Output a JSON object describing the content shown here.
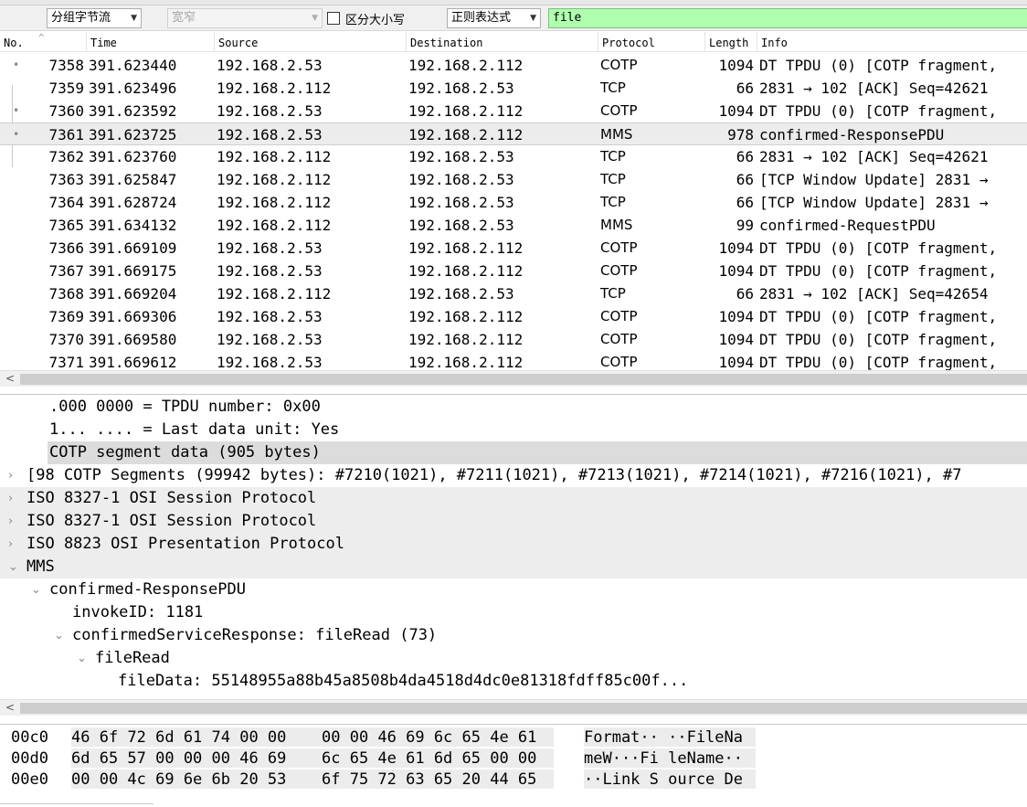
{
  "toolbar": {
    "search_in": "分组字节流",
    "char_width": "宽窄",
    "case_sensitive_label": "区分大小写",
    "search_type": "正则表达式",
    "search_value": "file"
  },
  "packet_list": {
    "columns": [
      "No.",
      "Time",
      "Source",
      "Destination",
      "Protocol",
      "Length",
      "Info"
    ],
    "selected_index": 3,
    "rows": [
      {
        "no": "7358",
        "time": "391.623440",
        "src": "192.168.2.53",
        "dst": "192.168.2.112",
        "proto": "COTP",
        "len": "1094",
        "info": "DT TPDU (0) [COTP fragment,"
      },
      {
        "no": "7359",
        "time": "391.623496",
        "src": "192.168.2.112",
        "dst": "192.168.2.53",
        "proto": "TCP",
        "len": "66",
        "info": "2831 → 102 [ACK] Seq=42621"
      },
      {
        "no": "7360",
        "time": "391.623592",
        "src": "192.168.2.53",
        "dst": "192.168.2.112",
        "proto": "COTP",
        "len": "1094",
        "info": "DT TPDU (0) [COTP fragment,"
      },
      {
        "no": "7361",
        "time": "391.623725",
        "src": "192.168.2.53",
        "dst": "192.168.2.112",
        "proto": "MMS",
        "len": "978",
        "info": "confirmed-ResponsePDU"
      },
      {
        "no": "7362",
        "time": "391.623760",
        "src": "192.168.2.112",
        "dst": "192.168.2.53",
        "proto": "TCP",
        "len": "66",
        "info": "2831 → 102 [ACK] Seq=42621"
      },
      {
        "no": "7363",
        "time": "391.625847",
        "src": "192.168.2.112",
        "dst": "192.168.2.53",
        "proto": "TCP",
        "len": "66",
        "info": "[TCP Window Update] 2831 →"
      },
      {
        "no": "7364",
        "time": "391.628724",
        "src": "192.168.2.112",
        "dst": "192.168.2.53",
        "proto": "TCP",
        "len": "66",
        "info": "[TCP Window Update] 2831 →"
      },
      {
        "no": "7365",
        "time": "391.634132",
        "src": "192.168.2.112",
        "dst": "192.168.2.53",
        "proto": "MMS",
        "len": "99",
        "info": "confirmed-RequestPDU"
      },
      {
        "no": "7366",
        "time": "391.669109",
        "src": "192.168.2.53",
        "dst": "192.168.2.112",
        "proto": "COTP",
        "len": "1094",
        "info": "DT TPDU (0) [COTP fragment,"
      },
      {
        "no": "7367",
        "time": "391.669175",
        "src": "192.168.2.53",
        "dst": "192.168.2.112",
        "proto": "COTP",
        "len": "1094",
        "info": "DT TPDU (0) [COTP fragment,"
      },
      {
        "no": "7368",
        "time": "391.669204",
        "src": "192.168.2.112",
        "dst": "192.168.2.53",
        "proto": "TCP",
        "len": "66",
        "info": "2831 → 102 [ACK] Seq=42654"
      },
      {
        "no": "7369",
        "time": "391.669306",
        "src": "192.168.2.53",
        "dst": "192.168.2.112",
        "proto": "COTP",
        "len": "1094",
        "info": "DT TPDU (0) [COTP fragment,"
      },
      {
        "no": "7370",
        "time": "391.669580",
        "src": "192.168.2.53",
        "dst": "192.168.2.112",
        "proto": "COTP",
        "len": "1094",
        "info": "DT TPDU (0) [COTP fragment,"
      },
      {
        "no": "7371",
        "time": "391.669612",
        "src": "192.168.2.53",
        "dst": "192.168.2.112",
        "proto": "COTP",
        "len": "1094",
        "info": "DT TPDU (0) [COTP fragment,"
      }
    ]
  },
  "details": {
    "rows": [
      {
        "text": ".000 0000 = TPDU number: 0x00",
        "twisty": "",
        "indent": 2,
        "gray": false
      },
      {
        "text": "1... .... = Last data unit: Yes",
        "twisty": "",
        "indent": 2,
        "gray": false
      },
      {
        "text": "COTP segment data (905 bytes)",
        "twisty": "",
        "indent": 2,
        "gray": false,
        "highlight": true
      },
      {
        "text": "[98 COTP Segments (99942 bytes): #7210(1021), #7211(1021), #7213(1021), #7214(1021), #7216(1021), #7",
        "twisty": "›",
        "indent": 1,
        "gray": false
      },
      {
        "text": "ISO 8327-1 OSI Session Protocol",
        "twisty": "›",
        "indent": 1,
        "gray": true
      },
      {
        "text": "ISO 8327-1 OSI Session Protocol",
        "twisty": "›",
        "indent": 1,
        "gray": true
      },
      {
        "text": "ISO 8823 OSI Presentation Protocol",
        "twisty": "›",
        "indent": 1,
        "gray": true
      },
      {
        "text": "MMS",
        "twisty": "⌄",
        "indent": 1,
        "gray": true
      },
      {
        "text": "confirmed-ResponsePDU",
        "twisty": "⌄",
        "indent": 2,
        "gray": false
      },
      {
        "text": "invokeID: 1181",
        "twisty": "",
        "indent": 3,
        "gray": false
      },
      {
        "text": "confirmedServiceResponse: fileRead (73)",
        "twisty": "⌄",
        "indent": 3,
        "gray": false
      },
      {
        "text": "fileRead",
        "twisty": "⌄",
        "indent": 4,
        "gray": false
      },
      {
        "text": "fileData: 55148955a88b45a8508b4da4518d4dc0e81318fdff85c00f...",
        "twisty": "",
        "indent": 5,
        "gray": false
      }
    ]
  },
  "hex": {
    "rows": [
      {
        "offset": "00c0",
        "bytes_a": "46 6f 72 6d 61 74 00 00",
        "bytes_b": "00 00 46 69 6c 65 4e 61",
        "ascii": "Format·· ··FileNa"
      },
      {
        "offset": "00d0",
        "bytes_a": "6d 65 57 00 00 00 46 69",
        "bytes_b": "6c 65 4e 61 6d 65 00 00",
        "ascii": "meW···Fi leName··"
      },
      {
        "offset": "00e0",
        "bytes_a": "00 00 4c 69 6e 6b 20 53",
        "bytes_b": "6f 75 72 63 65 20 44 65",
        "ascii": "··Link S ource De"
      }
    ]
  }
}
